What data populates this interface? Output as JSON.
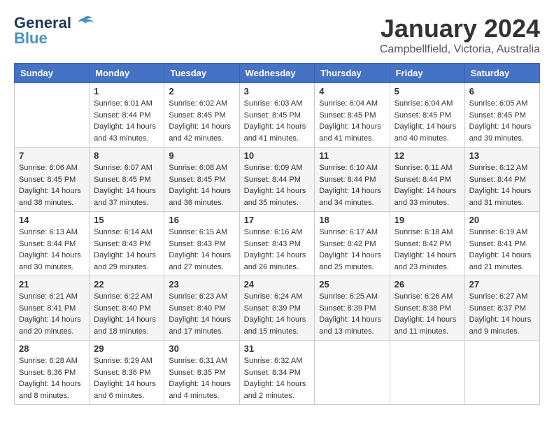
{
  "logo": {
    "line1": "General",
    "line2": "Blue"
  },
  "title": "January 2024",
  "location": "Campbellfield, Victoria, Australia",
  "header_days": [
    "Sunday",
    "Monday",
    "Tuesday",
    "Wednesday",
    "Thursday",
    "Friday",
    "Saturday"
  ],
  "weeks": [
    [
      {
        "day": "",
        "sunrise": "",
        "sunset": "",
        "daylight": ""
      },
      {
        "day": "1",
        "sunrise": "6:01 AM",
        "sunset": "8:44 PM",
        "daylight": "14 hours and 43 minutes."
      },
      {
        "day": "2",
        "sunrise": "6:02 AM",
        "sunset": "8:45 PM",
        "daylight": "14 hours and 42 minutes."
      },
      {
        "day": "3",
        "sunrise": "6:03 AM",
        "sunset": "8:45 PM",
        "daylight": "14 hours and 41 minutes."
      },
      {
        "day": "4",
        "sunrise": "6:04 AM",
        "sunset": "8:45 PM",
        "daylight": "14 hours and 41 minutes."
      },
      {
        "day": "5",
        "sunrise": "6:04 AM",
        "sunset": "8:45 PM",
        "daylight": "14 hours and 40 minutes."
      },
      {
        "day": "6",
        "sunrise": "6:05 AM",
        "sunset": "8:45 PM",
        "daylight": "14 hours and 39 minutes."
      }
    ],
    [
      {
        "day": "7",
        "sunrise": "6:06 AM",
        "sunset": "8:45 PM",
        "daylight": "14 hours and 38 minutes."
      },
      {
        "day": "8",
        "sunrise": "6:07 AM",
        "sunset": "8:45 PM",
        "daylight": "14 hours and 37 minutes."
      },
      {
        "day": "9",
        "sunrise": "6:08 AM",
        "sunset": "8:45 PM",
        "daylight": "14 hours and 36 minutes."
      },
      {
        "day": "10",
        "sunrise": "6:09 AM",
        "sunset": "8:44 PM",
        "daylight": "14 hours and 35 minutes."
      },
      {
        "day": "11",
        "sunrise": "6:10 AM",
        "sunset": "8:44 PM",
        "daylight": "14 hours and 34 minutes."
      },
      {
        "day": "12",
        "sunrise": "6:11 AM",
        "sunset": "8:44 PM",
        "daylight": "14 hours and 33 minutes."
      },
      {
        "day": "13",
        "sunrise": "6:12 AM",
        "sunset": "8:44 PM",
        "daylight": "14 hours and 31 minutes."
      }
    ],
    [
      {
        "day": "14",
        "sunrise": "6:13 AM",
        "sunset": "8:44 PM",
        "daylight": "14 hours and 30 minutes."
      },
      {
        "day": "15",
        "sunrise": "6:14 AM",
        "sunset": "8:43 PM",
        "daylight": "14 hours and 29 minutes."
      },
      {
        "day": "16",
        "sunrise": "6:15 AM",
        "sunset": "8:43 PM",
        "daylight": "14 hours and 27 minutes."
      },
      {
        "day": "17",
        "sunrise": "6:16 AM",
        "sunset": "8:43 PM",
        "daylight": "14 hours and 26 minutes."
      },
      {
        "day": "18",
        "sunrise": "6:17 AM",
        "sunset": "8:42 PM",
        "daylight": "14 hours and 25 minutes."
      },
      {
        "day": "19",
        "sunrise": "6:18 AM",
        "sunset": "8:42 PM",
        "daylight": "14 hours and 23 minutes."
      },
      {
        "day": "20",
        "sunrise": "6:19 AM",
        "sunset": "8:41 PM",
        "daylight": "14 hours and 21 minutes."
      }
    ],
    [
      {
        "day": "21",
        "sunrise": "6:21 AM",
        "sunset": "8:41 PM",
        "daylight": "14 hours and 20 minutes."
      },
      {
        "day": "22",
        "sunrise": "6:22 AM",
        "sunset": "8:40 PM",
        "daylight": "14 hours and 18 minutes."
      },
      {
        "day": "23",
        "sunrise": "6:23 AM",
        "sunset": "8:40 PM",
        "daylight": "14 hours and 17 minutes."
      },
      {
        "day": "24",
        "sunrise": "6:24 AM",
        "sunset": "8:39 PM",
        "daylight": "14 hours and 15 minutes."
      },
      {
        "day": "25",
        "sunrise": "6:25 AM",
        "sunset": "8:39 PM",
        "daylight": "14 hours and 13 minutes."
      },
      {
        "day": "26",
        "sunrise": "6:26 AM",
        "sunset": "8:38 PM",
        "daylight": "14 hours and 11 minutes."
      },
      {
        "day": "27",
        "sunrise": "6:27 AM",
        "sunset": "8:37 PM",
        "daylight": "14 hours and 9 minutes."
      }
    ],
    [
      {
        "day": "28",
        "sunrise": "6:28 AM",
        "sunset": "8:36 PM",
        "daylight": "14 hours and 8 minutes."
      },
      {
        "day": "29",
        "sunrise": "6:29 AM",
        "sunset": "8:36 PM",
        "daylight": "14 hours and 6 minutes."
      },
      {
        "day": "30",
        "sunrise": "6:31 AM",
        "sunset": "8:35 PM",
        "daylight": "14 hours and 4 minutes."
      },
      {
        "day": "31",
        "sunrise": "6:32 AM",
        "sunset": "8:34 PM",
        "daylight": "14 hours and 2 minutes."
      },
      {
        "day": "",
        "sunrise": "",
        "sunset": "",
        "daylight": ""
      },
      {
        "day": "",
        "sunrise": "",
        "sunset": "",
        "daylight": ""
      },
      {
        "day": "",
        "sunrise": "",
        "sunset": "",
        "daylight": ""
      }
    ]
  ]
}
